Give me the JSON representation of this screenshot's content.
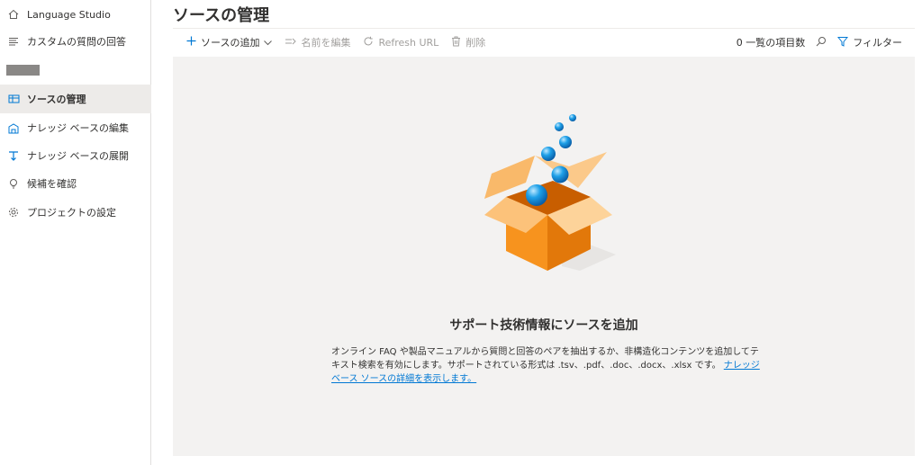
{
  "sidebar": {
    "items": [
      {
        "label": "Language Studio",
        "icon": "home-icon"
      },
      {
        "label": "カスタムの質問の回答",
        "icon": "list-icon"
      },
      {
        "label": "ソースの管理",
        "icon": "manage-sources-icon",
        "active": true
      },
      {
        "label": "ナレッジ ベースの編集",
        "icon": "edit-kb-icon"
      },
      {
        "label": "ナレッジ ベースの展開",
        "icon": "deploy-icon"
      },
      {
        "label": "候補を確認",
        "icon": "lightbulb-icon"
      },
      {
        "label": "プロジェクトの設定",
        "icon": "gear-icon"
      }
    ]
  },
  "header": {
    "title": "ソースの管理"
  },
  "toolbar": {
    "add_source": "ソースの追加",
    "rename": "名前を編集",
    "refresh_url": "Refresh URL",
    "delete": "削除",
    "count": "0 一覧の項目数",
    "filter": "フィルター"
  },
  "empty_state": {
    "title": "サポート技術情報にソースを追加",
    "description": "オンライン FAQ や製品マニュアルから質問と回答のペアを抽出するか、非構造化コンテンツを追加してテキスト検索を有効にします。サポートされている形式は .tsv、.pdf、.doc、.docx、.xlsx です。",
    "link": "ナレッジ ベース ソースの詳細を表示します。"
  },
  "colors": {
    "accent": "#0078d4",
    "box_orange": "#f7931e",
    "background": "#f3f2f1"
  }
}
